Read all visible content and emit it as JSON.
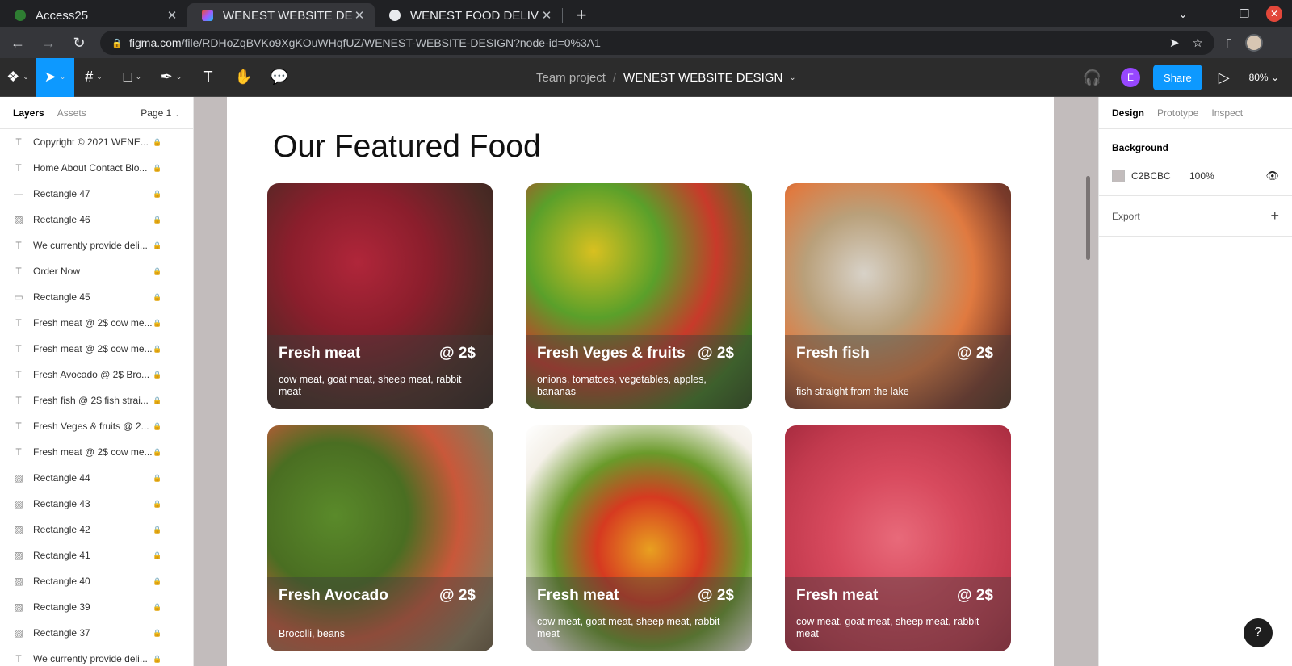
{
  "browser": {
    "tabs": [
      {
        "title": "Access25",
        "favicon_color": "#2e7d32"
      },
      {
        "title": "WENEST WEBSITE DESIGN",
        "favicon_color": "#f24e1e"
      },
      {
        "title": "WENEST FOOD DELIVERY",
        "favicon_color": "#e8eaed"
      }
    ],
    "url_domain": "figma.com",
    "url_path": "/file/RDHoZqBVKo9XgKOuWHqfUZ/WENEST-WEBSITE-DESIGN?node-id=0%3A1"
  },
  "figma": {
    "breadcrumb_team": "Team project",
    "breadcrumb_sep": "/",
    "file_name": "WENEST WEBSITE DESIGN",
    "avatar_letter": "E",
    "share_label": "Share",
    "zoom": "80%",
    "accent": "#0d99ff"
  },
  "left_panel": {
    "tab_layers": "Layers",
    "tab_assets": "Assets",
    "page": "Page 1",
    "layers": [
      {
        "icon": "T",
        "name": "Copyright © 2021 WENE..."
      },
      {
        "icon": "T",
        "name": "Home About Contact Blo..."
      },
      {
        "icon": "—",
        "name": "Rectangle 47"
      },
      {
        "icon": "▨",
        "name": "Rectangle 46"
      },
      {
        "icon": "T",
        "name": "We currently provide deli..."
      },
      {
        "icon": "T",
        "name": "Order Now"
      },
      {
        "icon": "▭",
        "name": "Rectangle 45"
      },
      {
        "icon": "T",
        "name": "Fresh meat @ 2$ cow me..."
      },
      {
        "icon": "T",
        "name": "Fresh meat @ 2$ cow me..."
      },
      {
        "icon": "T",
        "name": "Fresh Avocado @ 2$ Bro..."
      },
      {
        "icon": "T",
        "name": "Fresh fish @ 2$ fish strai..."
      },
      {
        "icon": "T",
        "name": "Fresh Veges & fruits @ 2..."
      },
      {
        "icon": "T",
        "name": "Fresh meat @ 2$ cow me..."
      },
      {
        "icon": "▨",
        "name": "Rectangle 44"
      },
      {
        "icon": "▨",
        "name": "Rectangle 43"
      },
      {
        "icon": "▨",
        "name": "Rectangle 42"
      },
      {
        "icon": "▨",
        "name": "Rectangle 41"
      },
      {
        "icon": "▨",
        "name": "Rectangle 40"
      },
      {
        "icon": "▨",
        "name": "Rectangle 39"
      },
      {
        "icon": "▨",
        "name": "Rectangle 37"
      },
      {
        "icon": "T",
        "name": "We currently provide deli..."
      }
    ]
  },
  "canvas": {
    "background": "#C2BCBC",
    "section_title": "Our Featured Food",
    "cards": [
      {
        "name": "Fresh meat",
        "price": "@ 2$",
        "desc": "cow meat, goat meat, sheep meat, rabbit meat",
        "bg": "radial-gradient(circle at 40% 35%, #b0263a 0%, #8b1e2c 35%, #4a2a24 70%, #2a201c 100%)"
      },
      {
        "name": "Fresh Veges & fruits",
        "price": "@ 2$",
        "desc": "onions, tomatoes, vegetables, apples, bananas",
        "bg": "radial-gradient(circle at 30% 30%, #d8c020 0%, #5aa02a 30%, #c83a2a 55%, #3f7a22 80%, #2c4a1a 100%)"
      },
      {
        "name": "Fresh fish",
        "price": "@ 2$",
        "desc": "fish straight from the lake",
        "bg": "radial-gradient(circle at 35% 40%, #d8d2c8 0%, #b9a07a 30%, #e07a40 55%, #7a3a2a 80%, #4a3020 100%)"
      },
      {
        "name": "Fresh Avocado",
        "price": "@ 2$",
        "desc": "Brocolli, beans",
        "bg": "radial-gradient(circle at 30% 40%, #5a8a2a 0%, #4a6e22 35%, #c9583a 60%, #8a7a5a 85%, #6a5a40 100%)"
      },
      {
        "name": "Fresh meat",
        "price": "@ 2$",
        "desc": "cow meat, goat meat, sheep meat, rabbit meat",
        "bg": "radial-gradient(circle at 55% 55%, #e8a020 0%, #d63a20 30%, #6a9a2a 55%, #f4f0e8 80%, #ffffff 100%)"
      },
      {
        "name": "Fresh meat",
        "price": "@ 2$",
        "desc": "cow meat, goat meat, sheep meat, rabbit meat",
        "bg": "radial-gradient(circle at 50% 50%, #e86a7a 0%, #d84a5e 40%, #c23a4e 75%, #a82c40 100%)"
      }
    ]
  },
  "right_panel": {
    "tab_design": "Design",
    "tab_prototype": "Prototype",
    "tab_inspect": "Inspect",
    "background_heading": "Background",
    "bg_hex": "C2BCBC",
    "bg_opacity": "100%",
    "export_label": "Export"
  },
  "help_label": "?"
}
